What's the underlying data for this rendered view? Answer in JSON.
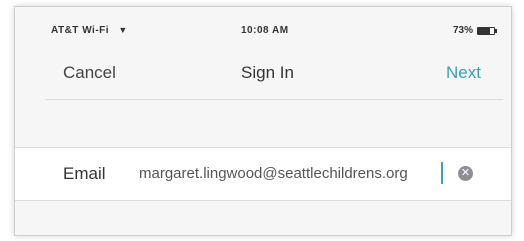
{
  "status_bar": {
    "carrier": "AT&T Wi-Fi",
    "wifi_icon": "wifi-icon",
    "time": "10:08 AM",
    "battery_percent": "73%",
    "battery_level": 0.73
  },
  "nav": {
    "cancel_label": "Cancel",
    "title": "Sign In",
    "next_label": "Next",
    "accent_color": "#3aa0b4"
  },
  "form": {
    "email_label": "Email",
    "email_value": "margaret.lingwood@seattlechildrens.org",
    "clear_icon": "clear-circle-icon"
  }
}
